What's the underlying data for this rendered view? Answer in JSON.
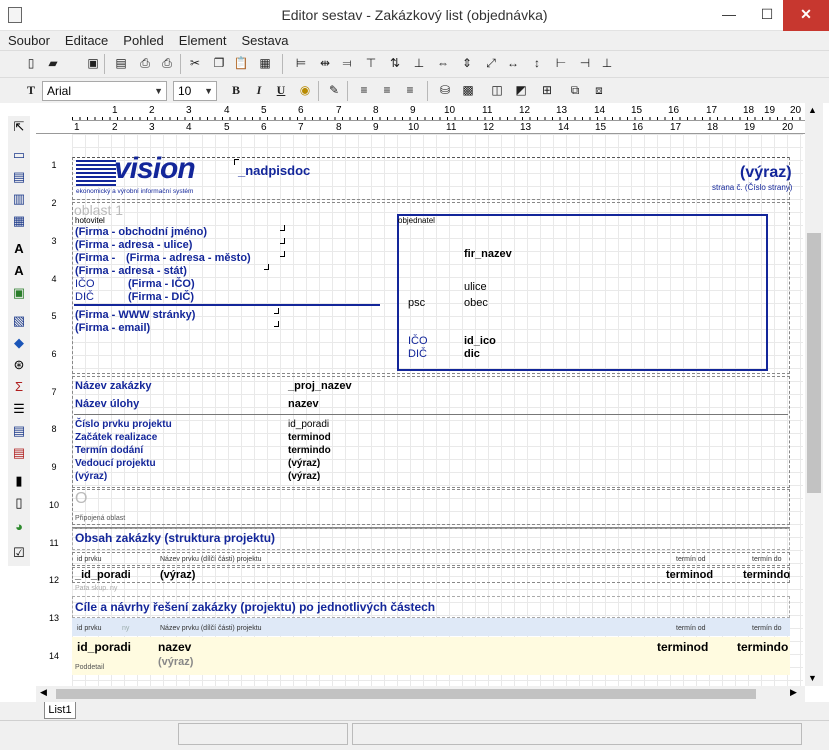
{
  "window": {
    "title": "Editor sestav - Zakázkový list (objednávka)",
    "min": "—",
    "max": "☐",
    "close": "✕"
  },
  "menu": [
    "Soubor",
    "Editace",
    "Pohled",
    "Element",
    "Sestava"
  ],
  "toolbar": {
    "font": "Arial",
    "size": "10",
    "bold": "B",
    "italic": "I",
    "underline": "U"
  },
  "ruler": {
    "top": [
      "1",
      "2",
      "3",
      "4",
      "5",
      "6",
      "7",
      "8",
      "9",
      "10",
      "11",
      "12",
      "13",
      "14",
      "15",
      "16",
      "17",
      "18",
      "19",
      "20"
    ],
    "sub": [
      "1",
      "2",
      "3",
      "4",
      "5",
      "6",
      "7",
      "8",
      "9",
      "10",
      "11",
      "12",
      "13",
      "14",
      "15",
      "16",
      "17",
      "18",
      "19",
      "20"
    ]
  },
  "band_numbers": [
    "1",
    "2",
    "3",
    "4",
    "5",
    "6",
    "7",
    "8",
    "9",
    "10",
    "11",
    "12",
    "13",
    "14"
  ],
  "header": {
    "logo_word": "vision",
    "logo_sub": "ekonomický a výrobní informační systém",
    "nadpisdoc": "_nadpisdoc",
    "vyraz": "(výraz)",
    "page_expr": "strana č. (Číslo strany)"
  },
  "supplier": {
    "ghost": "oblast 1",
    "caption": "hotovitel",
    "name": "(Firma - obchodní jméno)",
    "street": "(Firma - adresa - ulice)",
    "city_a": "(Firma -",
    "city_b": "(Firma - adresa - město)",
    "state": "(Firma - adresa - stát)",
    "ico_label": "IČO",
    "ico": "(Firma - IČO)",
    "dic_label": "DIČ",
    "dic": "(Firma - DIČ)",
    "web": "(Firma - WWW stránky)",
    "email": "(Firma - email)"
  },
  "customer": {
    "caption": "objednatel",
    "name": "fir_nazev",
    "street": "ulice",
    "psc": "psc",
    "city": "obec",
    "ico_label": "IČO",
    "ico": "id_ico",
    "dic_label": "DIČ",
    "dic": "dic"
  },
  "order": {
    "label_zakazka": "Název zakázky",
    "proj_nazev": "_proj_nazev",
    "label_uloha": "Název úlohy",
    "nazev": "nazev",
    "rows": [
      {
        "label": "Číslo prvku projektu",
        "value": "id_poradi"
      },
      {
        "label": "Začátek realizace",
        "value": "terminod"
      },
      {
        "label": "Termín dodání",
        "value": "termindo"
      },
      {
        "label": "Vedoucí projektu",
        "value": "(výraz)"
      },
      {
        "label": "(výraz)",
        "value": "(výraz)"
      }
    ]
  },
  "attached": {
    "ghost": "O",
    "caption": "Připojená oblast"
  },
  "section1": {
    "title": "Obsah zakázky (struktura projektu)",
    "col_id": "id prvku",
    "col_name": "Název prvku (dílčí části) projektu",
    "col_od": "termín od",
    "col_do": "termín do",
    "id_poradi": "_id_poradi",
    "vyraz": "(výraz)",
    "terminod": "terminod",
    "termindo": "termindo",
    "footer": "Pata skup. ny"
  },
  "section2": {
    "title": "Cíle a návrhy řešení zakázky (projektu) po jednotlivých částech",
    "col_id": "id prvku",
    "col_hint": "ny",
    "col_name": "Název prvku (dílčí části) projektu",
    "col_od": "termín od",
    "col_do": "termín do",
    "id_poradi": "id_poradi",
    "nazev": "nazev",
    "terminod": "terminod",
    "termindo": "termindo",
    "vyraz": "(výraz)",
    "subdetail": "Poddetail"
  },
  "sheet_tab": "List1"
}
